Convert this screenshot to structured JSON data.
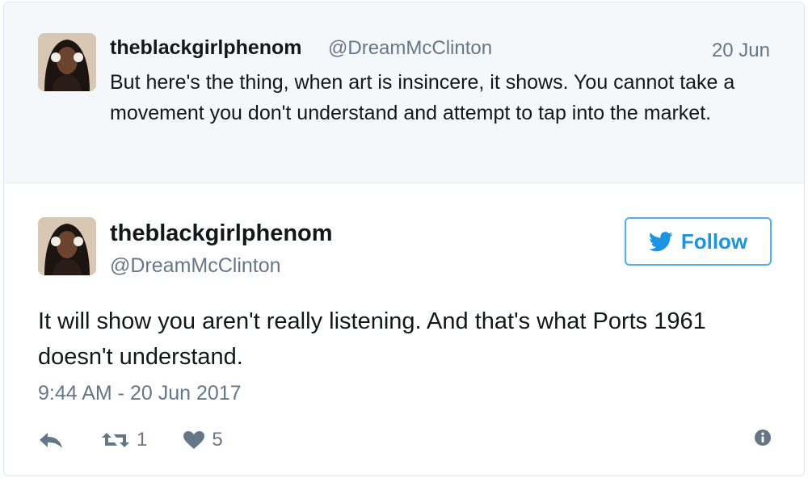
{
  "parent_tweet": {
    "display_name": "theblackgirlphenom",
    "handle": "@DreamMcClinton",
    "date": "20 Jun",
    "text": "But here's the thing, when art is insincere, it shows. You cannot take a movement you don't understand and attempt to tap into the market."
  },
  "main_tweet": {
    "display_name": "theblackgirlphenom",
    "handle": "@DreamMcClinton",
    "follow_label": "Follow",
    "text": "It will show you aren't really listening. And that's what Ports 1961 doesn't understand.",
    "timestamp": "9:44 AM - 20 Jun 2017",
    "retweet_count": "1",
    "like_count": "5"
  },
  "icons": {
    "avatar": "avatar",
    "twitter_bird": "twitter-bird-icon",
    "reply": "reply-icon",
    "retweet": "retweet-icon",
    "like": "heart-icon",
    "info": "info-icon"
  },
  "colors": {
    "accent": "#1b95e0",
    "border_accent": "#55acee",
    "muted_text": "#657786",
    "parent_background": "#f5f8fa"
  }
}
